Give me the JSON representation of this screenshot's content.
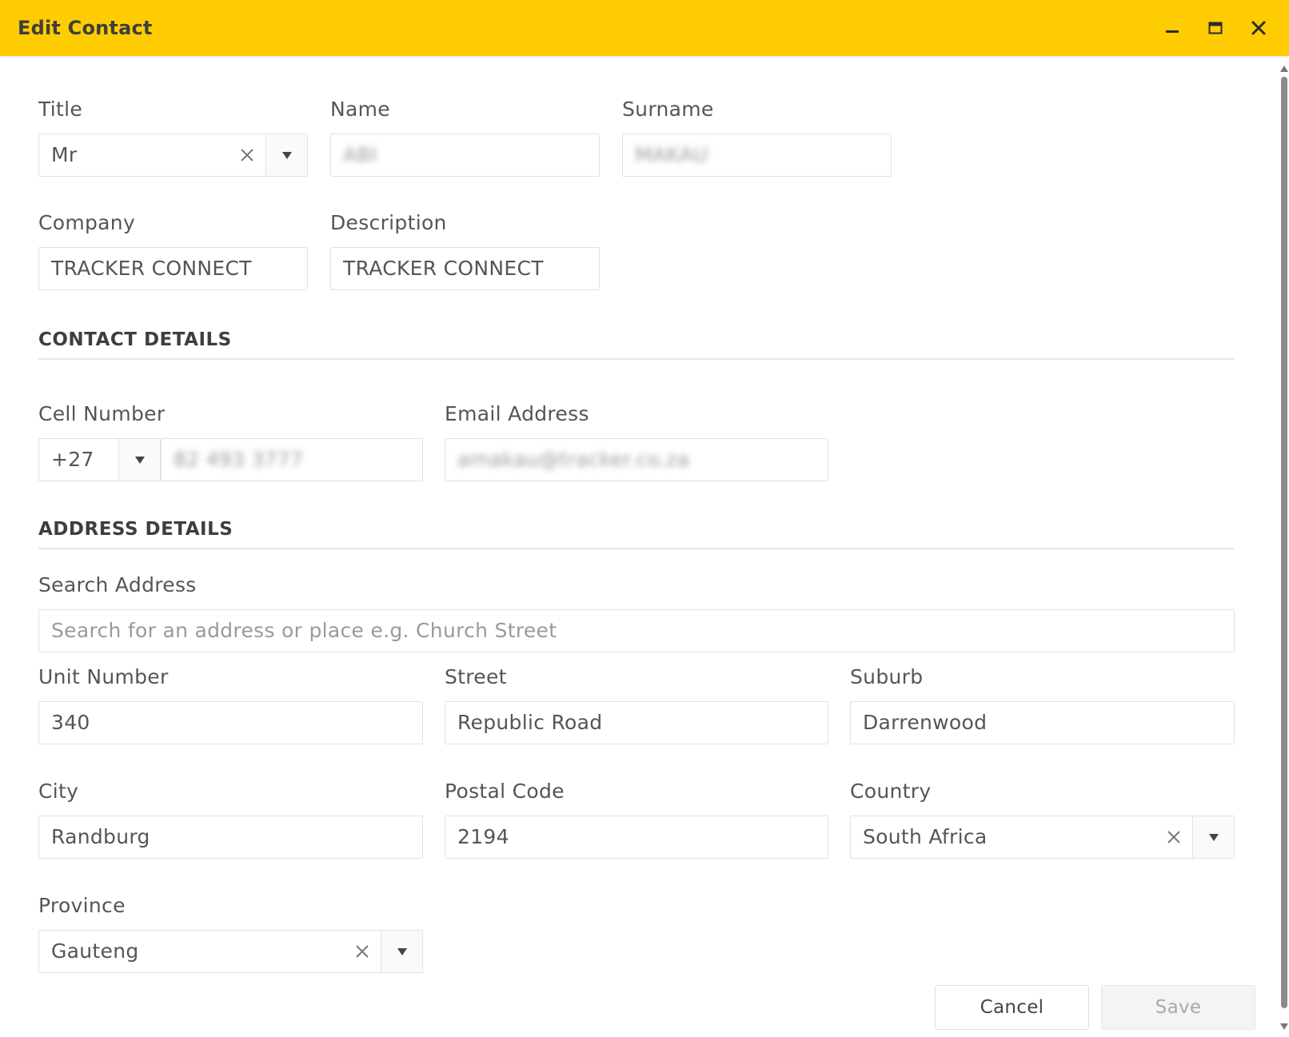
{
  "window": {
    "title": "Edit Contact",
    "controls": [
      "minimize-icon",
      "maximize-icon",
      "close-icon"
    ]
  },
  "colors": {
    "titlebar": "#fecc00",
    "text": "#555555",
    "border": "#e2e2e2"
  },
  "form": {
    "title": {
      "label": "Title",
      "value": "Mr"
    },
    "name": {
      "label": "Name",
      "value": "ABI"
    },
    "surname": {
      "label": "Surname",
      "value": "MAKAU"
    },
    "company": {
      "label": "Company",
      "value": "TRACKER CONNECT"
    },
    "description": {
      "label": "Description",
      "value": "TRACKER CONNECT"
    }
  },
  "contact": {
    "heading": "CONTACT DETAILS",
    "cell": {
      "label": "Cell Number",
      "code": "+27",
      "value": "82 493 3777"
    },
    "email": {
      "label": "Email Address",
      "value": "amakau@tracker.co.za"
    }
  },
  "address": {
    "heading": "ADDRESS DETAILS",
    "search": {
      "label": "Search Address",
      "placeholder": "Search for an address or place e.g. Church Street"
    },
    "unit": {
      "label": "Unit Number",
      "value": "340"
    },
    "street": {
      "label": "Street",
      "value": "Republic Road"
    },
    "suburb": {
      "label": "Suburb",
      "value": "Darrenwood"
    },
    "city": {
      "label": "City",
      "value": "Randburg"
    },
    "postal": {
      "label": "Postal Code",
      "value": "2194"
    },
    "country": {
      "label": "Country",
      "value": "South Africa"
    },
    "province": {
      "label": "Province",
      "value": "Gauteng"
    }
  },
  "buttons": {
    "cancel": "Cancel",
    "save": "Save"
  }
}
